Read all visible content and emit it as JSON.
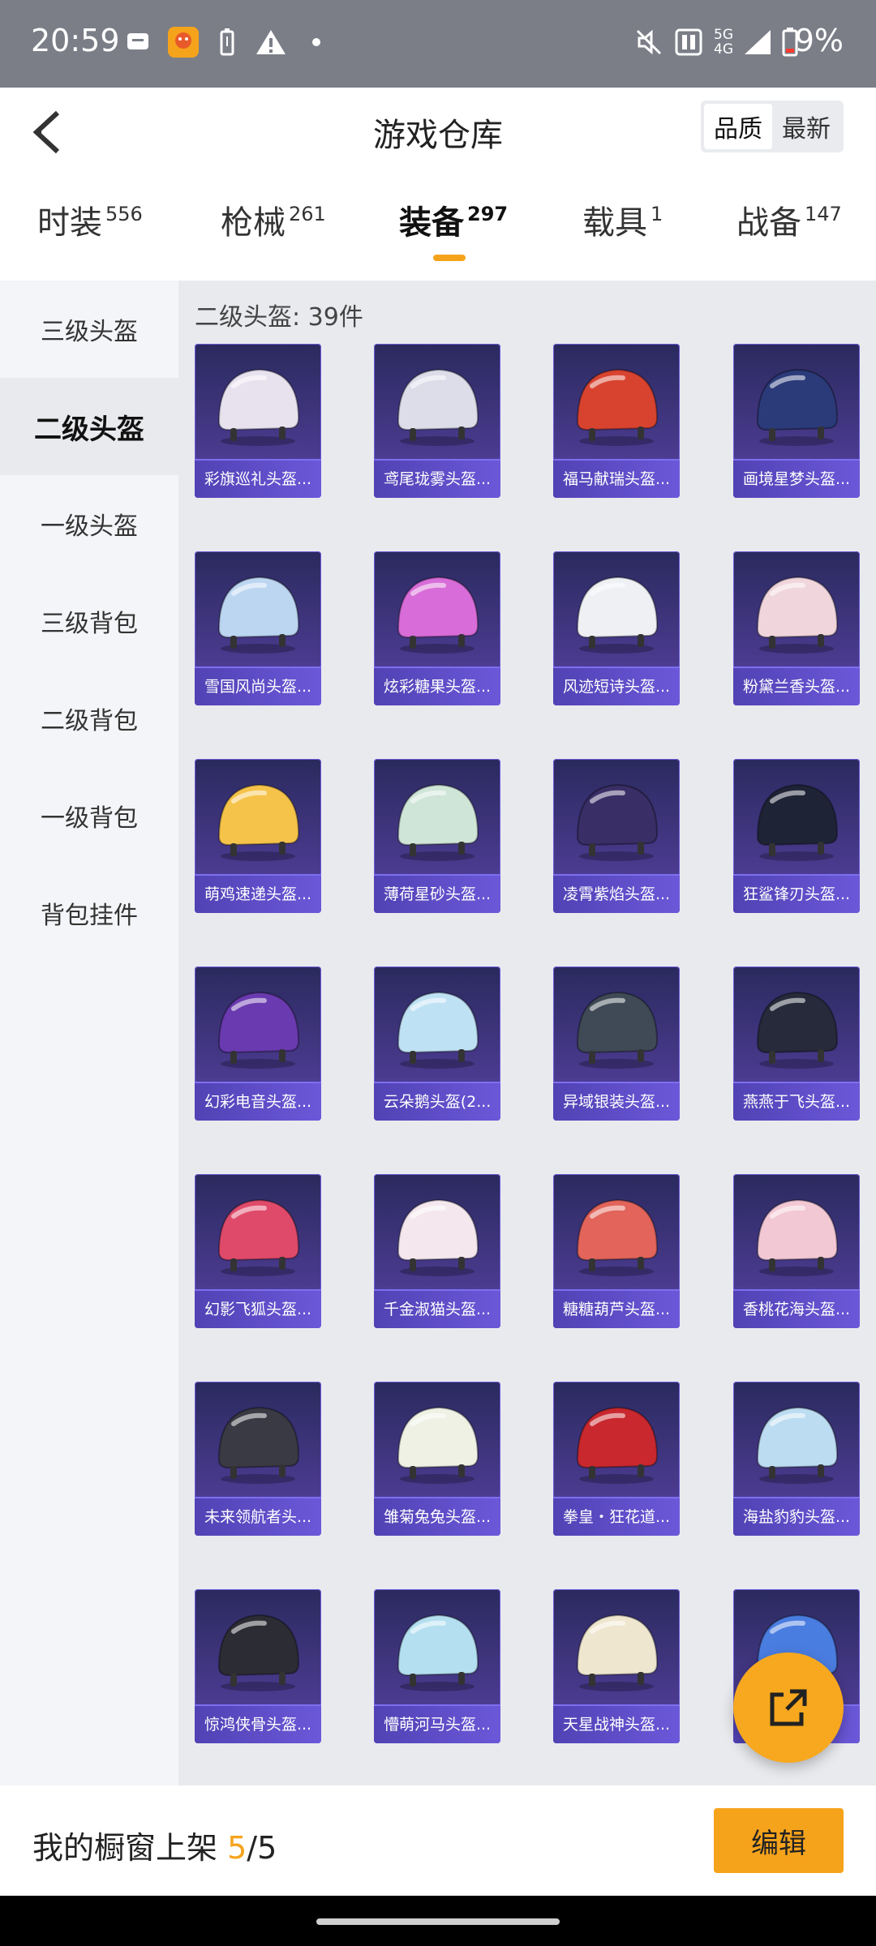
{
  "status_bar": {
    "time": "20:59",
    "battery": "9%",
    "network_top": "5G",
    "network_bottom": "4G"
  },
  "header": {
    "title": "游戏仓库",
    "sort_options": [
      "品质",
      "最新"
    ],
    "sort_active": "品质"
  },
  "tabs": [
    {
      "label": "时装",
      "count": "556"
    },
    {
      "label": "枪械",
      "count": "261"
    },
    {
      "label": "装备",
      "count": "297",
      "active": true
    },
    {
      "label": "载具",
      "count": "1"
    },
    {
      "label": "战备",
      "count": "147"
    }
  ],
  "sidebar": [
    {
      "label": "三级头盔"
    },
    {
      "label": "二级头盔",
      "active": true
    },
    {
      "label": "一级头盔"
    },
    {
      "label": "三级背包"
    },
    {
      "label": "二级背包"
    },
    {
      "label": "一级背包"
    },
    {
      "label": "背包挂件"
    }
  ],
  "section": {
    "title": "二级头盔: 39件"
  },
  "items": [
    {
      "name": "彩旗巡礼头盔...",
      "color": "#e8e2ef"
    },
    {
      "name": "鸢尾珑雾头盔...",
      "color": "#dcdde8"
    },
    {
      "name": "福马献瑞头盔...",
      "color": "#d8432f"
    },
    {
      "name": "画境星梦头盔...",
      "color": "#2b3b7a"
    },
    {
      "name": "雪国风尚头盔...",
      "color": "#bcd6f2"
    },
    {
      "name": "炫彩糖果头盔...",
      "color": "#d86cd8"
    },
    {
      "name": "风迹短诗头盔...",
      "color": "#eef0f4"
    },
    {
      "name": "粉黛兰香头盔...",
      "color": "#f0d6dc"
    },
    {
      "name": "萌鸡速递头盔...",
      "color": "#f6c34a"
    },
    {
      "name": "薄荷星砂头盔...",
      "color": "#cfe5d8"
    },
    {
      "name": "凌霄紫焰头盔...",
      "color": "#3a2e66"
    },
    {
      "name": "狂鲨锋刃头盔...",
      "color": "#1e2436"
    },
    {
      "name": "幻彩电音头盔...",
      "color": "#6a3ab0"
    },
    {
      "name": "云朵鹅头盔(2...",
      "color": "#bfe1f4"
    },
    {
      "name": "异域银装头盔...",
      "color": "#3f4a56"
    },
    {
      "name": "燕燕于飞头盔...",
      "color": "#262a3a"
    },
    {
      "name": "幻影飞狐头盔...",
      "color": "#e04a6a"
    },
    {
      "name": "千金淑猫头盔...",
      "color": "#f4e8ee"
    },
    {
      "name": "糖糖葫芦头盔...",
      "color": "#e2645a"
    },
    {
      "name": "香桃花海头盔...",
      "color": "#f2c8d4"
    },
    {
      "name": "未来领航者头...",
      "color": "#3a3a44"
    },
    {
      "name": "雏菊兔兔头盔...",
      "color": "#eef1e4"
    },
    {
      "name": "拳皇・狂花道...",
      "color": "#c8282e"
    },
    {
      "name": "海盐豹豹头盔...",
      "color": "#bcdcf2"
    },
    {
      "name": "惊鸿侠骨头盔...",
      "color": "#2c2c34"
    },
    {
      "name": "懵萌河马头盔...",
      "color": "#b4dff0"
    },
    {
      "name": "天星战神头盔...",
      "color": "#efe6cf"
    },
    {
      "name": "",
      "color": "#4a7de0"
    }
  ],
  "bottom": {
    "shelf_label": "我的橱窗上架 ",
    "shelf_used": "5",
    "shelf_total": "/5",
    "edit_label": "编辑"
  },
  "colors": {
    "accent": "#f6a31c",
    "card_bg": "#4a3a8e"
  }
}
